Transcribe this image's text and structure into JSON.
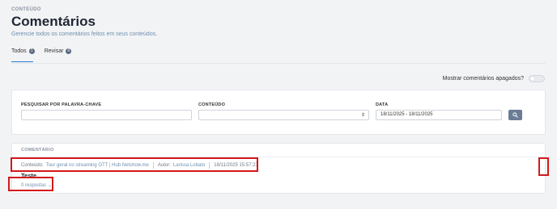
{
  "header": {
    "eyebrow": "CONTEÚDO",
    "title": "Comentários",
    "subtitle": "Gerencie todos os comentários feitos em seus conteúdos."
  },
  "tabs": [
    {
      "label": "Todos",
      "count": "1"
    },
    {
      "label": "Revisar",
      "count": "0"
    }
  ],
  "toggle": {
    "label": "Mostrar comentários apagados?",
    "on": false
  },
  "filters": {
    "keyword_label": "PESQUISAR POR PALAVRA-CHAVE",
    "keyword_value": "",
    "content_label": "CONTEÚDO",
    "content_value": "",
    "date_label": "DATA",
    "date_value": "18/11/2025 - 18/11/2025",
    "search_icon": "search-icon"
  },
  "comments": {
    "column_header": "COMENTÁRIO",
    "items": [
      {
        "content_prefix": "Conteúdo:",
        "content_title": "Tour geral no streaming OTT | Hub Netshow.me",
        "author_prefix": "Autor:",
        "author_name": "Larissa Lobato",
        "timestamp": "18/11/2025 15:57:27",
        "text": "Teste.",
        "replies": "0 respostas",
        "menu_icon": "kebab-menu-icon"
      }
    ]
  },
  "colors": {
    "accent": "#2b7fd6",
    "highlight": "#d31919",
    "search_button": "#6b7c95"
  }
}
